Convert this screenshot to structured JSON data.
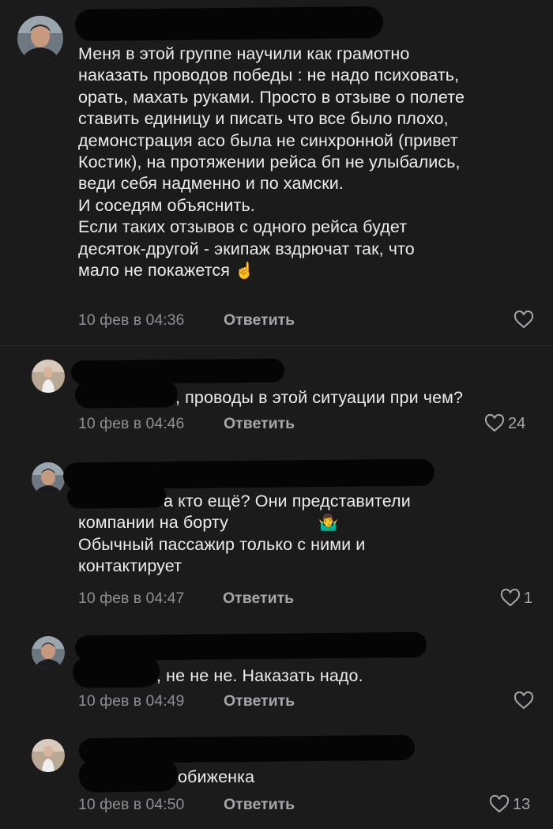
{
  "comments": [
    {
      "text": "Меня в этой группе научили как грамотно\nнаказать проводов победы : не надо психовать,\nорать, махать руками. Просто в отзыве о полете\nставить единицу и писать что все было плохо,\nдемонстрация асо была не синхронной (привет\nКостик), на протяжении рейса бп не улыбались,\nведи себя надменно и по хамски.\nИ соседям объяснить.\nЕсли таких отзывов с одного рейса будет\nдесяток-другой - экипаж вздрючат так, что\nмало не покажется",
      "emoji": "☝️",
      "time": "10 фев в 04:36",
      "reply": "Ответить",
      "likes": ""
    },
    {
      "text": ", проводы в этой ситуации при чем?",
      "time": "10 фев в 04:46",
      "reply": "Ответить",
      "likes": "24"
    },
    {
      "text": "а кто ещё? Они представители\nкомпании на борту",
      "emoji": "🤷‍♂️",
      "text2": "Обычный пассажир только с ними и\nконтактирует",
      "time": "10 фев в 04:47",
      "reply": "Ответить",
      "likes": "1"
    },
    {
      "text": ", не не не. Наказать надо.",
      "time": "10 фев в 04:49",
      "reply": "Ответить",
      "likes": ""
    },
    {
      "text": "обиженка",
      "time": "10 фев в 04:50",
      "reply": "Ответить",
      "likes": "13"
    }
  ]
}
